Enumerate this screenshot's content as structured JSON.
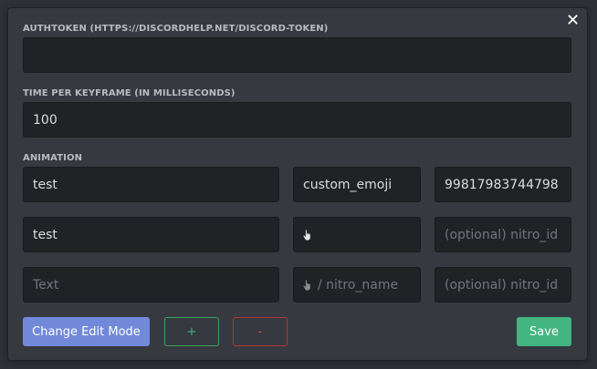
{
  "dialog": {
    "close_glyph": "✕",
    "authtoken_label": "AUTHTOKEN (HTTPS://DISCORDHELP.NET/DISCORD-TOKEN)",
    "authtoken_value": "",
    "interval_label": "TIME PER KEYFRAME (IN MILLISECONDS)",
    "interval_value": "100",
    "animation_label": "ANIMATION"
  },
  "animation_rows": [
    {
      "text": "test",
      "emoji": "custom_emoji",
      "nitro_id": "99817983744798"
    },
    {
      "text": "test",
      "emoji_icon": "pointing-hand-icon",
      "nitro_id_placeholder": "(optional) nitro_id"
    },
    {
      "text_placeholder": "Text",
      "emoji_placeholder": "/ nitro_name",
      "nitro_id_placeholder": "(optional) nitro_id"
    }
  ],
  "buttons": {
    "change_mode": "Change Edit Mode",
    "add": "+",
    "remove": "-",
    "save": "Save"
  },
  "colors": {
    "accent": "#7289da",
    "success": "#43b581",
    "danger": "#f04747",
    "background": "#36393f",
    "input": "#202225"
  }
}
